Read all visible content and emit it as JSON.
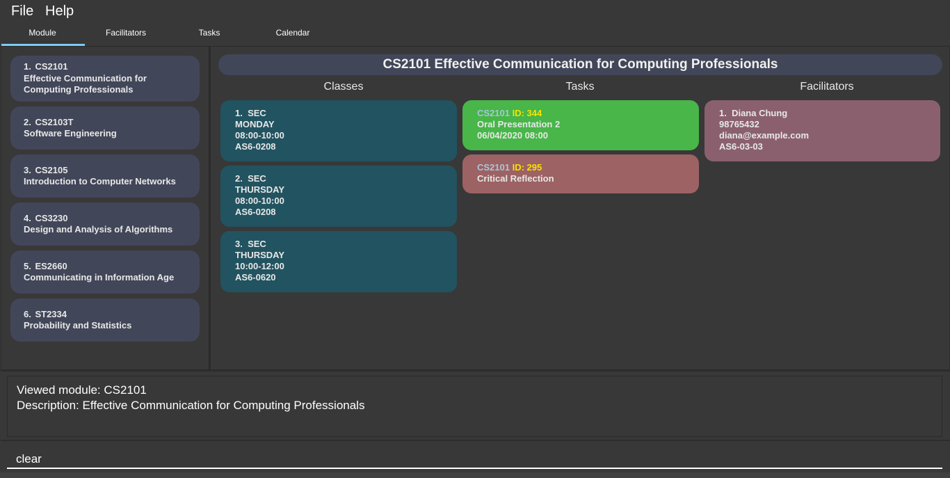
{
  "menubar": {
    "items": [
      "File",
      "Help"
    ]
  },
  "tabs": [
    {
      "label": "Module",
      "active": true
    },
    {
      "label": "Facilitators",
      "active": false
    },
    {
      "label": "Tasks",
      "active": false
    },
    {
      "label": "Calendar",
      "active": false
    }
  ],
  "modules": [
    {
      "index": "1.",
      "code": "CS2101",
      "description": "Effective Communication for Computing Professionals"
    },
    {
      "index": "2.",
      "code": "CS2103T",
      "description": "Software Engineering"
    },
    {
      "index": "3.",
      "code": "CS2105",
      "description": "Introduction to Computer Networks"
    },
    {
      "index": "4.",
      "code": "CS3230",
      "description": "Design and Analysis of Algorithms"
    },
    {
      "index": "5.",
      "code": "ES2660",
      "description": "Communicating in Information Age"
    },
    {
      "index": "6.",
      "code": "ST2334",
      "description": "Probability and Statistics"
    }
  ],
  "detail": {
    "title": "CS2101 Effective Communication for Computing Professionals",
    "headers": {
      "classes": "Classes",
      "tasks": "Tasks",
      "facilitators": "Facilitators"
    },
    "classes": [
      {
        "index": "1.",
        "type": "SEC",
        "day": "MONDAY",
        "time": "08:00-10:00",
        "venue": "AS6-0208"
      },
      {
        "index": "2.",
        "type": "SEC",
        "day": "THURSDAY",
        "time": "08:00-10:00",
        "venue": "AS6-0208"
      },
      {
        "index": "3.",
        "type": "SEC",
        "day": "THURSDAY",
        "time": "10:00-12:00",
        "venue": "AS6-0620"
      }
    ],
    "tasks": [
      {
        "module": "CS2101",
        "id": "ID: 344",
        "name": "Oral Presentation 2",
        "datetime": "06/04/2020 08:00",
        "status_color": "#48b649"
      },
      {
        "module": "CS2101",
        "id": "ID: 295",
        "name": "Critical Reflection",
        "datetime": "",
        "status_color": "#9d6264"
      }
    ],
    "facilitators": [
      {
        "index": "1.",
        "name": "Diana Chung",
        "phone": "98765432",
        "email": "diana@example.com",
        "office": "AS6-03-03"
      }
    ]
  },
  "result": {
    "line1": "Viewed module: CS2101",
    "line2": "Description: Effective Communication for Computing Professionals"
  },
  "command": {
    "value": "clear"
  },
  "colors": {
    "accent_tab_underline": "#7ecbf5",
    "module_card": "#424659",
    "class_card": "#225360",
    "facilitator_card": "#8a606f",
    "task_module_code": "#a6c8d8",
    "task_id": "#f5e400"
  }
}
